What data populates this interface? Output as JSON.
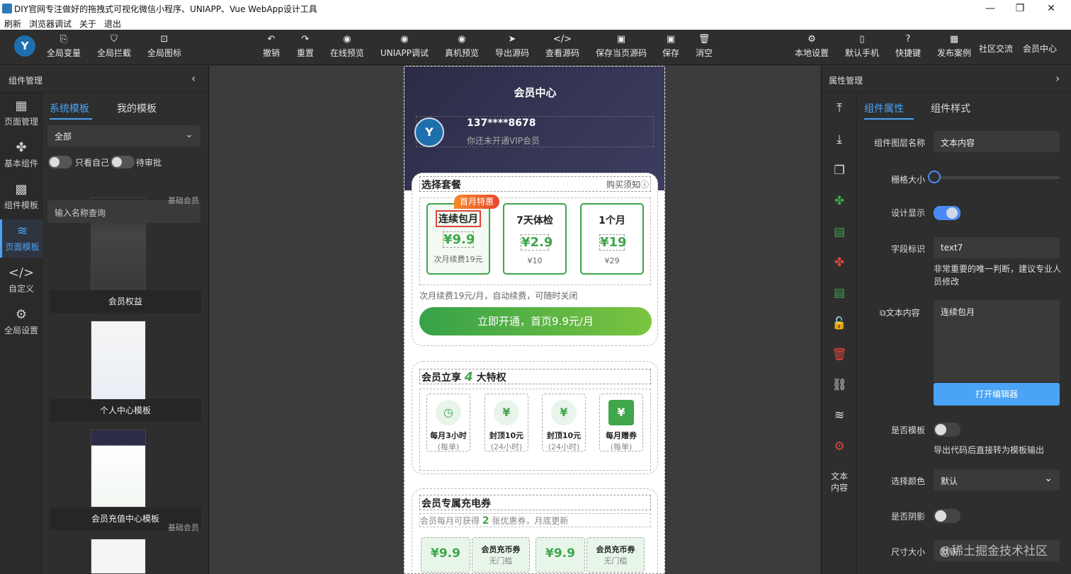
{
  "window": {
    "title": "DIY官网专注做好的拖拽式可视化微信小程序、UNIAPP、Vue WebApp设计工具",
    "minimize": "—",
    "maximize": "❐",
    "close": "✕"
  },
  "menu": [
    "刷新",
    "浏览器调试",
    "关于",
    "退出"
  ],
  "toolbar": {
    "logo": "Y",
    "left": [
      {
        "label": "全局变量",
        "icon": "⎘"
      },
      {
        "label": "全局拦截",
        "icon": "⛉"
      },
      {
        "label": "全局图标",
        "icon": "⊡"
      }
    ],
    "center": [
      {
        "label": "撤销",
        "icon": "↶"
      },
      {
        "label": "重置",
        "icon": "↷"
      },
      {
        "label": "在线预览",
        "icon": "◉"
      },
      {
        "label": "UNIAPP调试",
        "icon": "◉"
      },
      {
        "label": "真机预览",
        "icon": "◉"
      },
      {
        "label": "导出源码",
        "icon": "➤"
      },
      {
        "label": "查看源码",
        "icon": "</>"
      },
      {
        "label": "保存当页源码",
        "icon": "▣"
      },
      {
        "label": "保存",
        "icon": "▣"
      },
      {
        "label": "消空",
        "icon": "🗑"
      }
    ],
    "right": [
      {
        "label": "本地设置",
        "icon": "⚙"
      },
      {
        "label": "默认手机",
        "icon": "▯"
      },
      {
        "label": "快捷键",
        "icon": "?"
      },
      {
        "label": "发布案例",
        "icon": "▦"
      }
    ],
    "community": "社区交流",
    "member_center": "会员中心"
  },
  "left_panel": {
    "title": "组件管理",
    "collapse_icon": "‹",
    "nav": [
      {
        "label": "页面管理",
        "icon": "▦"
      },
      {
        "label": "基本组件",
        "icon": "✤"
      },
      {
        "label": "组件模板",
        "icon": "▩"
      },
      {
        "label": "页面模板",
        "icon": "≋"
      },
      {
        "label": "自定义",
        "icon": "</>"
      },
      {
        "label": "全局设置",
        "icon": "⚙"
      }
    ],
    "tabs": [
      "系统模板",
      "我的模板"
    ],
    "category_select": "全部",
    "toggle_mine": "只看自己",
    "toggle_pending": "待审批",
    "search_placeholder": "输入名称查询",
    "templates": [
      {
        "name": "会员权益",
        "tag": "基础会员"
      },
      {
        "name": "个人中心模板",
        "tag": ""
      },
      {
        "name": "会员充值中心模板",
        "tag": "基础会员"
      }
    ],
    "top_tag": "基础会员"
  },
  "phone": {
    "title": "会员中心",
    "avatar_text": "Y",
    "user_name": "137****8678",
    "vip_status": "你还未开通VIP会员",
    "package_section": {
      "title": "选择套餐",
      "notice": "购买须知ⓘ",
      "badge": "首月特惠",
      "packages": [
        {
          "name": "连续包月",
          "price": "¥9.9",
          "renew": "次月续费19元"
        },
        {
          "name": "7天体检",
          "price": "¥2.9",
          "renew": "¥10"
        },
        {
          "name": "1个月",
          "price": "¥19",
          "renew": "¥29"
        }
      ],
      "note": "次月续费19元/月，自动续费，可随时关闭",
      "button": "立即开通，首页9.9元/月"
    },
    "perks_section": {
      "title_prefix": "会员立享",
      "title_count": "4",
      "title_suffix": "大特权",
      "perks": [
        {
          "name": "每月3小时",
          "sub": "(每单)",
          "icon": "◷"
        },
        {
          "name": "封顶10元",
          "sub": "(24小时)",
          "icon": "¥"
        },
        {
          "name": "封顶10元",
          "sub": "(24小时)",
          "icon": "¥"
        },
        {
          "name": "每月赠券",
          "sub": "(每单)",
          "icon": "¥"
        }
      ]
    },
    "coupon_section": {
      "title": "会员专属充电券",
      "sub_prefix": "会员每月可获得",
      "sub_count": "2",
      "sub_suffix": "张优惠券，月底更新",
      "coupons": [
        {
          "value": "¥9.9",
          "name": "会员充币券",
          "sub": "无门槛"
        },
        {
          "value": "¥9.9",
          "name": "会员充币券",
          "sub": "无门槛"
        }
      ]
    }
  },
  "right_panel": {
    "title": "属性管理",
    "expand_icon": "›",
    "tools": [
      {
        "name": "move-top",
        "icon": "⤒",
        "color": "#dddddd"
      },
      {
        "name": "move-bottom",
        "icon": "⤓",
        "color": "#dddddd"
      },
      {
        "name": "copy",
        "icon": "❐",
        "color": "#dddddd"
      },
      {
        "name": "puzzle-green",
        "icon": "✤",
        "color": "#3fa64b"
      },
      {
        "name": "doc-green",
        "icon": "▤",
        "color": "#3fa64b"
      },
      {
        "name": "puzzle-red",
        "icon": "✤",
        "color": "#e0443a"
      },
      {
        "name": "doc-edit-green",
        "icon": "▤",
        "color": "#3fa64b"
      },
      {
        "name": "unlock",
        "icon": "🔓",
        "color": "#dddddd"
      },
      {
        "name": "delete",
        "icon": "🗑",
        "color": "#e0443a"
      },
      {
        "name": "link",
        "icon": "⛓",
        "color": "#dddddd"
      },
      {
        "name": "layers",
        "icon": "≋",
        "color": "#dddddd"
      },
      {
        "name": "settings-red",
        "icon": "⚙",
        "color": "#e0443a"
      }
    ],
    "current_component": "文本\n内容",
    "tabs": [
      "组件属性",
      "组件样式"
    ],
    "fields": {
      "layer_name_label": "组件图层名称",
      "layer_name_value": "文本内容",
      "grid_size_label": "栅格大小",
      "grid_size_value": 0,
      "design_show_label": "设计显示",
      "design_show_on": true,
      "field_id_label": "字段标识",
      "field_id_value": "text7",
      "field_id_hint": "非常重要的唯一判断，建议专业人员修改",
      "text_content_label": "⧉文本内容",
      "text_content_value": "连续包月",
      "open_editor": "打开编辑器",
      "is_template_label": "是否模板",
      "is_template_on": false,
      "is_template_hint": "导出代码后直接转为模板输出",
      "color_label": "选择颜色",
      "color_value": "默认",
      "shadow_label": "是否阴影",
      "shadow_on": false,
      "size_label": "尺寸大小",
      "size_value": "默认"
    }
  },
  "watermark": "@稀土掘金技术社区",
  "colors": {
    "accent": "#4aa3f5",
    "brand_green": "#3fa64b",
    "danger": "#e0443a"
  }
}
